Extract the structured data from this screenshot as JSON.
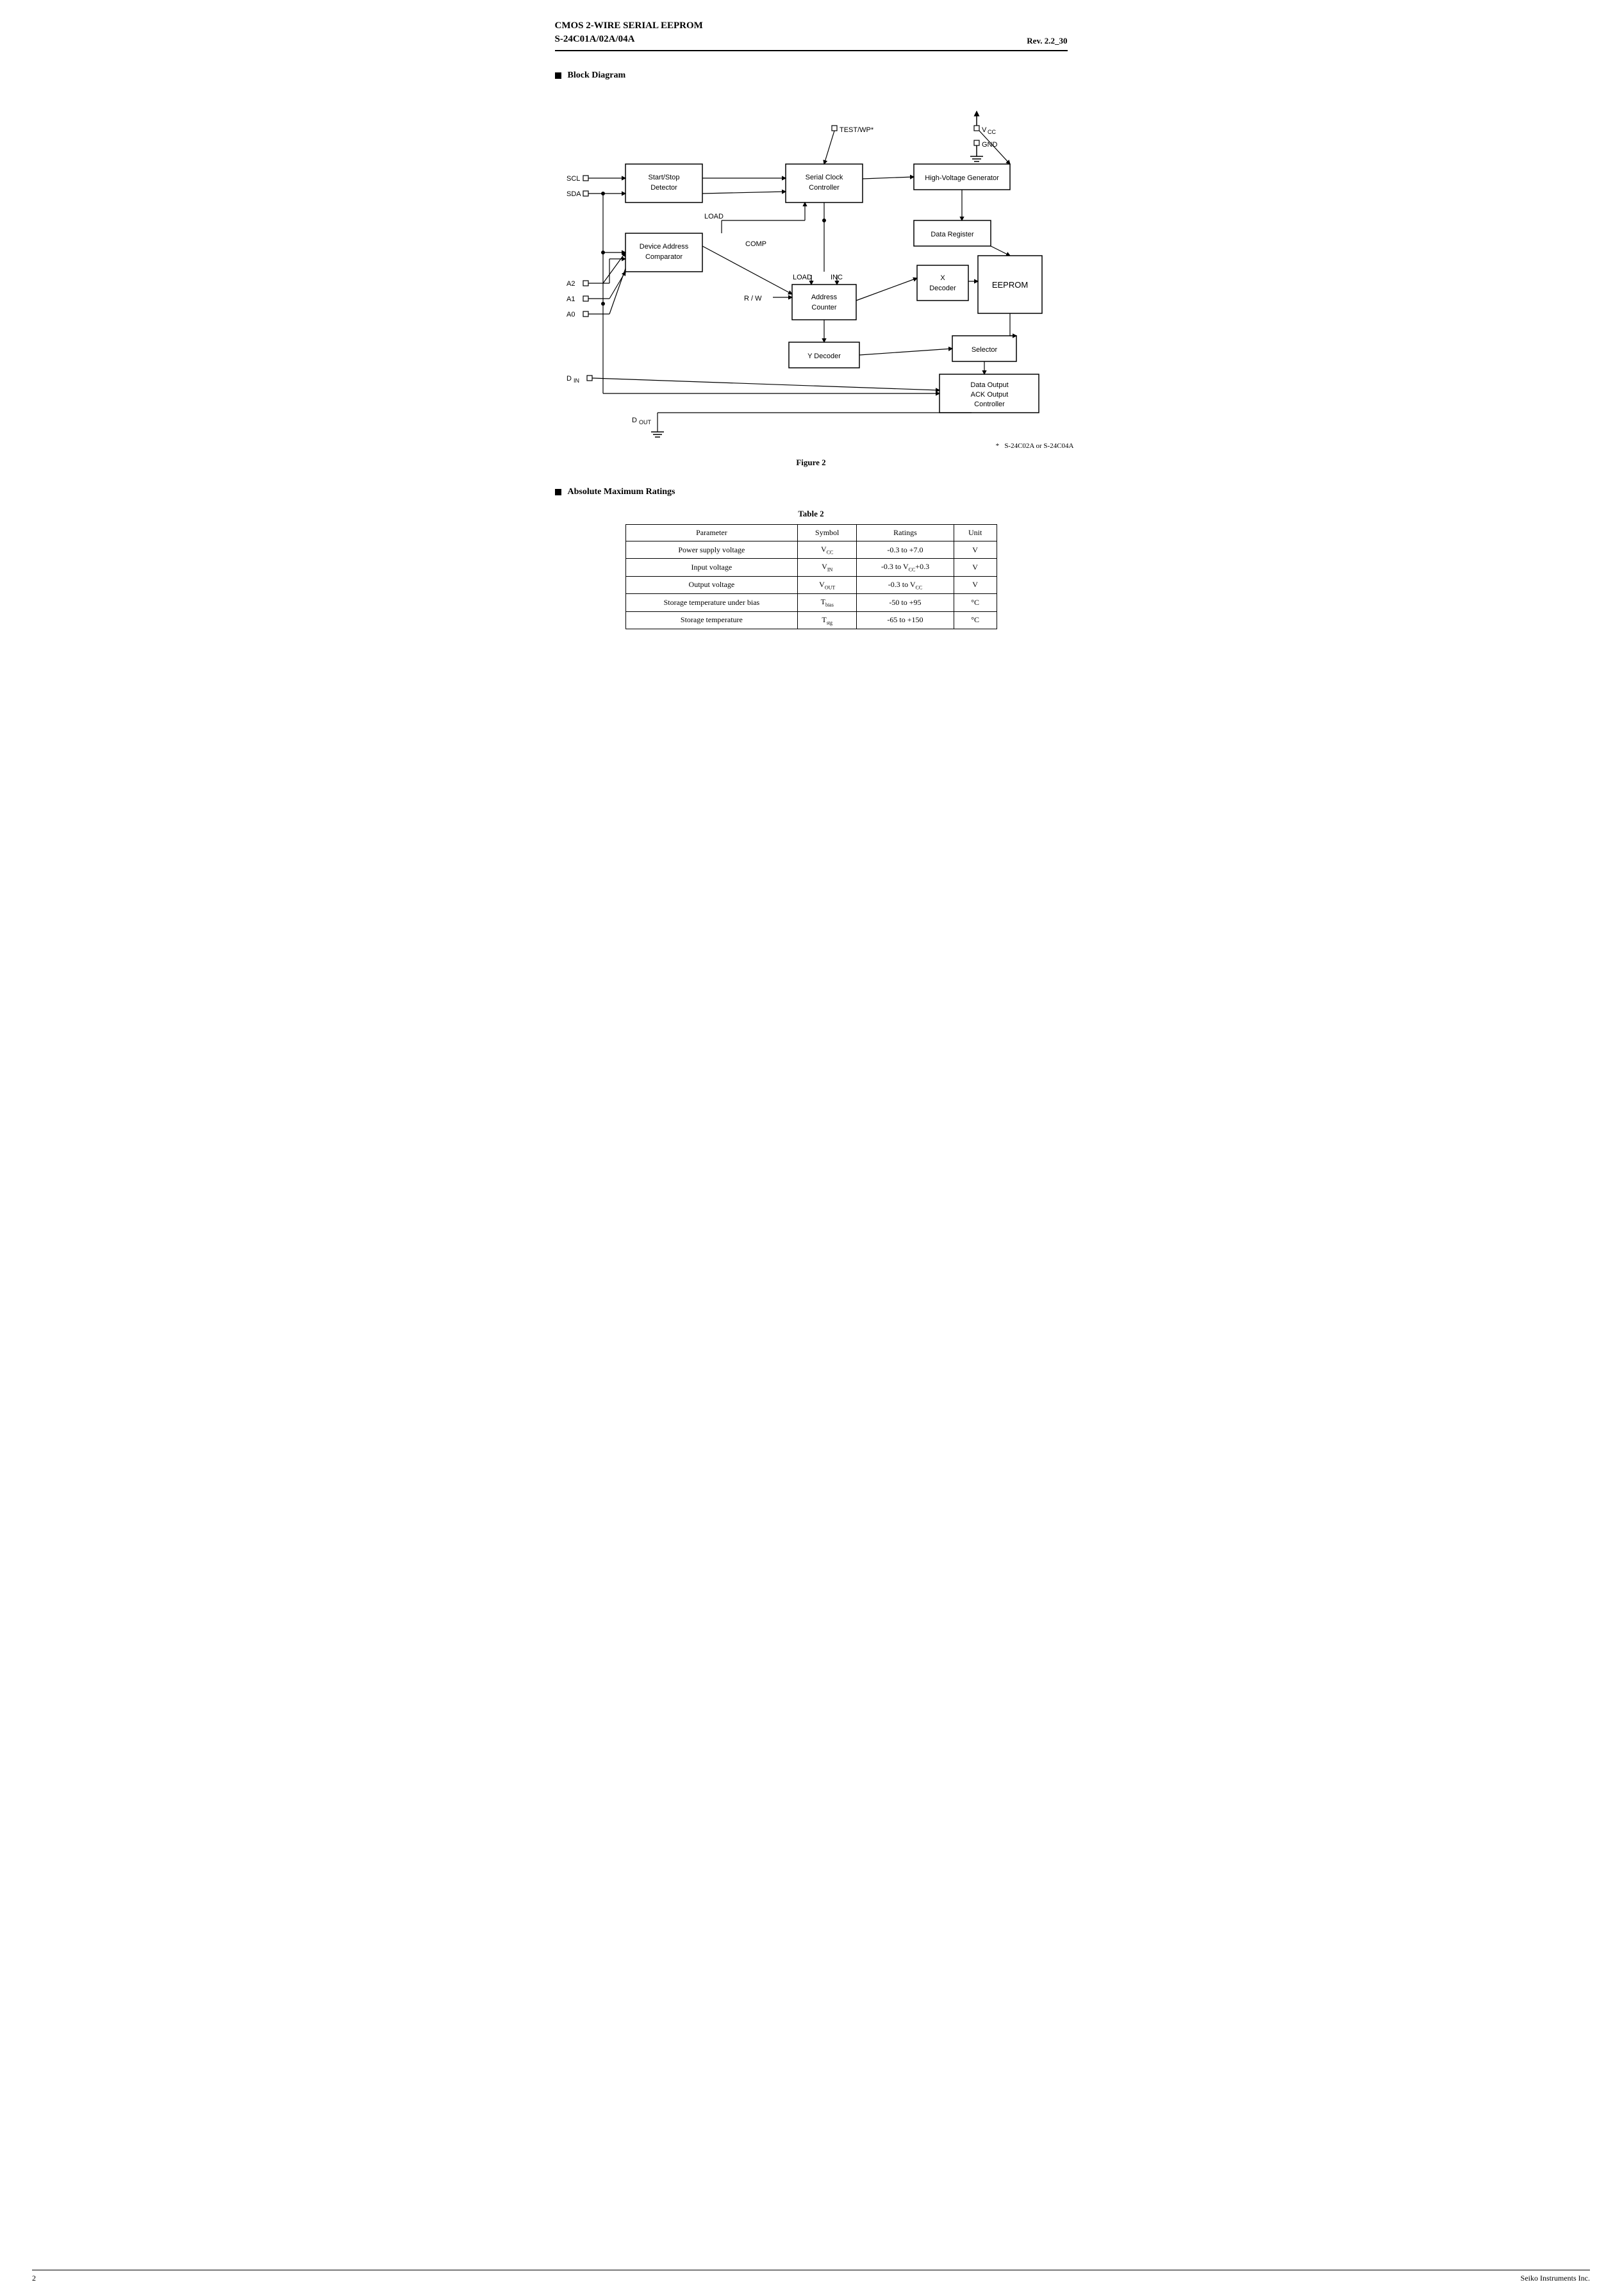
{
  "header": {
    "title_line1": "CMOS 2-WIRE SERIAL  EEPROM",
    "title_line2": "S-24C01A/02A/04A",
    "rev": "Rev. 2.2_30"
  },
  "sections": {
    "block_diagram": {
      "heading": "Block Diagram",
      "figure_caption": "Figure 2",
      "footnote": "*   S-24C02A or S-24C04A"
    },
    "absolute_max": {
      "heading": "Absolute Maximum Ratings",
      "table_caption": "Table  2",
      "columns": [
        "Parameter",
        "Symbol",
        "Ratings",
        "Unit"
      ],
      "rows": [
        [
          "Power supply voltage",
          "Vₙₕₑ",
          "-0.3 to +7.0",
          "V"
        ],
        [
          "Input voltage",
          "Vᴵₙ",
          "-0.3 to Vₙₕₑ+0.3",
          "V"
        ],
        [
          "Output voltage",
          "Vₒᵁᵀ",
          "-0.3 to Vₙₕₑ",
          "V"
        ],
        [
          "Storage temperature under bias",
          "Tᵇᴵₐₛ",
          "-50 to +95",
          "°C"
        ],
        [
          "Storage temperature",
          "Tₛₜᵧ",
          "-65 to +150",
          "°C"
        ]
      ]
    }
  },
  "footer": {
    "page": "2",
    "company": "Seiko Instruments Inc."
  }
}
